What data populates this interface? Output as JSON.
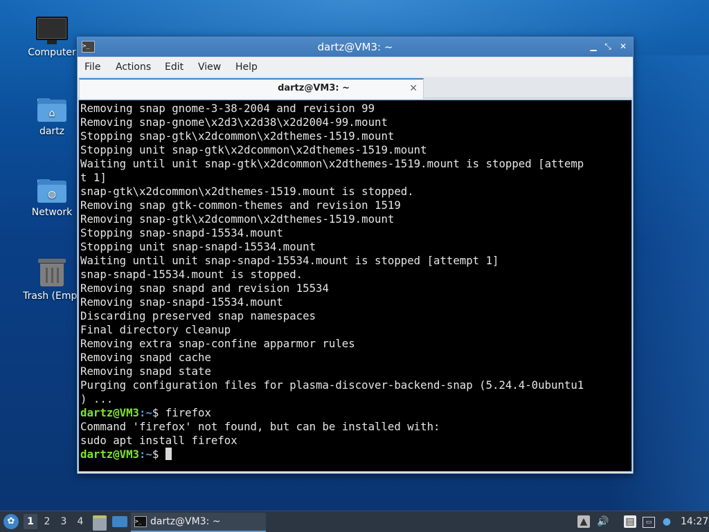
{
  "desktop": {
    "icons": [
      {
        "label": "Computer",
        "icon": "monitor-icon"
      },
      {
        "label": "dartz",
        "icon": "home-folder-icon"
      },
      {
        "label": "Network",
        "icon": "network-folder-icon"
      },
      {
        "label": "Trash (Empt",
        "icon": "trash-icon"
      }
    ]
  },
  "window": {
    "title": "dartz@VM3: ~",
    "menu": [
      "File",
      "Actions",
      "Edit",
      "View",
      "Help"
    ],
    "tab_label": "dartz@VM3: ~",
    "terminal": {
      "output_lines": [
        "Removing snap gnome-3-38-2004 and revision 99",
        "Removing snap-gnome\\x2d3\\x2d38\\x2d2004-99.mount",
        "Stopping snap-gtk\\x2dcommon\\x2dthemes-1519.mount",
        "Stopping unit snap-gtk\\x2dcommon\\x2dthemes-1519.mount",
        "Waiting until unit snap-gtk\\x2dcommon\\x2dthemes-1519.mount is stopped [attemp",
        "t 1]",
        "snap-gtk\\x2dcommon\\x2dthemes-1519.mount is stopped.",
        "Removing snap gtk-common-themes and revision 1519",
        "Removing snap-gtk\\x2dcommon\\x2dthemes-1519.mount",
        "Stopping snap-snapd-15534.mount",
        "Stopping unit snap-snapd-15534.mount",
        "Waiting until unit snap-snapd-15534.mount is stopped [attempt 1]",
        "snap-snapd-15534.mount is stopped.",
        "Removing snap snapd and revision 15534",
        "Removing snap-snapd-15534.mount",
        "Discarding preserved snap namespaces",
        "Final directory cleanup",
        "Removing extra snap-confine apparmor rules",
        "Removing snapd cache",
        "Removing snapd state",
        "Purging configuration files for plasma-discover-backend-snap (5.24.4-0ubuntu1",
        ") ..."
      ],
      "prompt_user": "dartz@VM3",
      "prompt_path": ":~",
      "prompt_symbol": "$",
      "command": " firefox",
      "after_command": [
        "Command 'firefox' not found, but can be installed with:",
        "sudo apt install firefox"
      ],
      "colors": {
        "user": "#7fe32f",
        "path": "#5c98e6",
        "text": "#e6e6e6"
      }
    }
  },
  "panel": {
    "workspaces": [
      "1",
      "2",
      "3",
      "4"
    ],
    "task_label": "dartz@VM3: ~",
    "clock": "14:27",
    "tray_icons": [
      "volume-icon",
      "clipboard-icon",
      "network-icon",
      "update-icon"
    ]
  }
}
